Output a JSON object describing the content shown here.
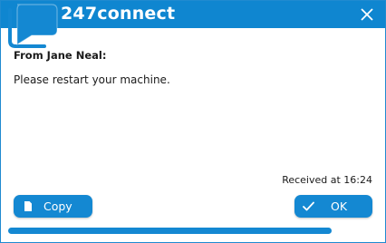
{
  "window": {
    "app_title": "247connect",
    "close_icon": "close-icon",
    "logo_icon": "chat-bubble-logo-icon"
  },
  "message": {
    "sender": "From Jane Neal:",
    "body": "Please restart your machine.",
    "received": "Received at 16:24"
  },
  "actions": {
    "copy_label": "Copy",
    "copy_icon": "document-icon",
    "ok_label": "OK",
    "ok_icon": "checkmark-icon"
  },
  "progress": {
    "fraction": 0.875
  },
  "colors": {
    "accent": "#0f86d0",
    "button": "#1488d2",
    "text": "#1a1a1a",
    "title_text": "#ffffff"
  }
}
